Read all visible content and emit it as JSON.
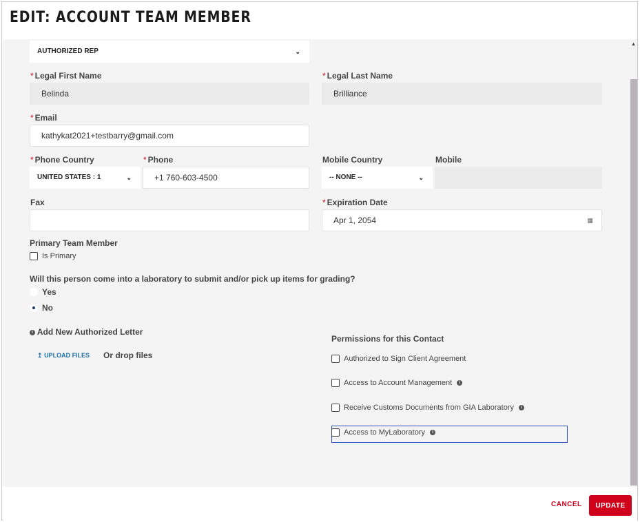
{
  "title": "EDIT: ACCOUNT TEAM MEMBER",
  "role_select": {
    "value": "AUTHORIZED REP"
  },
  "first_name": {
    "label": "Legal First Name",
    "value": "Belinda",
    "required": "*"
  },
  "last_name": {
    "label": "Legal Last Name",
    "value": "Brilliance",
    "required": "*"
  },
  "email": {
    "label": "Email",
    "value": "kathykat2021+testbarry@gmail.com",
    "required": "*"
  },
  "phone_country": {
    "label": "Phone Country",
    "value": "UNITED STATES : 1",
    "required": "*"
  },
  "phone": {
    "label": "Phone",
    "value": "+1 760-603-4500",
    "required": "*"
  },
  "mobile_country": {
    "label": "Mobile Country",
    "value": "-- NONE --"
  },
  "mobile": {
    "label": "Mobile",
    "value": ""
  },
  "fax": {
    "label": "Fax",
    "value": ""
  },
  "expiration": {
    "label": "Expiration Date",
    "value": "Apr 1, 2054",
    "required": "*"
  },
  "primary": {
    "label": "Primary Team Member",
    "checkbox_label": "Is Primary"
  },
  "lab_question": {
    "text": "Will this person come into a laboratory to submit and/or pick up items for grading?",
    "options": [
      "Yes",
      "No"
    ],
    "selected": "No"
  },
  "auth_letter": {
    "label": "Add New Authorized Letter",
    "upload_label": "UPLOAD FILES",
    "drop_label": "Or drop files"
  },
  "permissions": {
    "title": "Permissions for this Contact",
    "items": [
      "Authorized to Sign Client Agreement",
      "Access to Account Management",
      "Receive Customs Documents from GIA Laboratory",
      "Access to MyLaboratory"
    ]
  },
  "footer": {
    "cancel": "CANCEL",
    "update": "UPDATE"
  },
  "colors": {
    "accent": "#d0021b",
    "link": "#1b6fa8"
  }
}
